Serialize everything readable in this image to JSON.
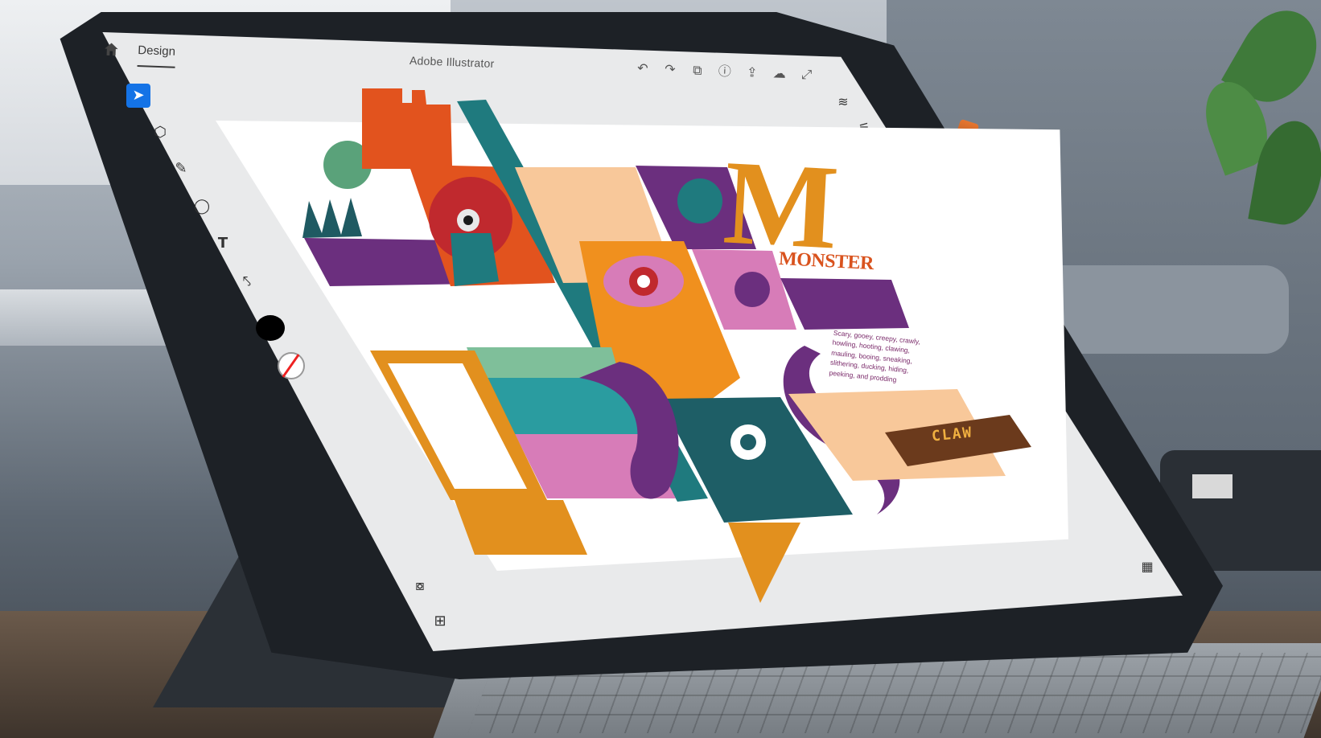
{
  "app": {
    "title": "Adobe Illustrator",
    "tab_design": "Design"
  },
  "toolbar_left": {
    "select_label": "➤",
    "direct_select_label": "⬡",
    "pencil_label": "✎",
    "shape_label": "◯",
    "type_label": "T",
    "image_tool_label": "⤣"
  },
  "header_actions": {
    "undo": "↶",
    "redo": "↷",
    "shapes": "⧉",
    "info": "ⓘ",
    "share": "⇪",
    "cloud": "☁",
    "expand": "⤢"
  },
  "right_panel": {
    "layers": "≋",
    "properties": "⚟",
    "artboards": "▦"
  },
  "bottom_left": {
    "camera": "⧇",
    "add_image": "⊞"
  },
  "artwork": {
    "big_letter": "M",
    "title": "MONSTER",
    "blurb": "Scary, gooey, creepy, crawly, howling, hooting, clawing, mauling, booing, sneaking, slithering, ducking, hiding, peeking, and prodding",
    "claw": "CLAW"
  },
  "colors": {
    "accent": "#1473e6",
    "orange": "#e2901e",
    "red_orange": "#e2531e",
    "teal": "#1f7a7e",
    "purple": "#6b2f7e",
    "pink": "#d77cb8",
    "peach": "#f8c89a"
  }
}
